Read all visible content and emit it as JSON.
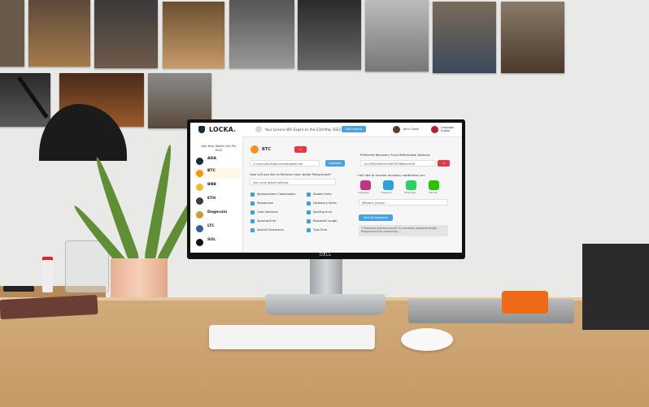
{
  "monitor_brand": "DELL",
  "app": {
    "logo": "LOCKA.",
    "license_notice": "Your Licence Will Expire on the 23rd May 2022",
    "get_license": "Get Licence",
    "user_name": "John Carey",
    "language_label": "Language",
    "language_value": "English"
  },
  "sidebar": {
    "add_wallet": "Add New Wallet Get File Here",
    "coins": [
      {
        "name": "ADA",
        "color": "#1b2a3a"
      },
      {
        "name": "BTC",
        "color": "#f7931a"
      },
      {
        "name": "BNB",
        "color": "#f3ba2f"
      },
      {
        "name": "ETH",
        "color": "#3c3c3d"
      },
      {
        "name": "Dogecoin",
        "color": "#c8a02f"
      },
      {
        "name": "LTC",
        "color": "#345d9d"
      },
      {
        "name": "SOL",
        "color": "#111111"
      }
    ]
  },
  "main": {
    "coin_title": "BTC",
    "wallet_path": "C:\\Users\\ASUS\\Documents\\wallet.dat",
    "upload_label": "Uploaded",
    "recover_question": "How will you like to Recover your wallet Passphrase?",
    "recover_select": "Use Locka default settings",
    "options_left": [
      "Alphanumeric Combination",
      "Passphrase",
      "Case Sensitive",
      "Spacing Error",
      "Special Characters"
    ],
    "options_right": [
      "Double Entry",
      "Dictionary Items",
      "Spelling Error",
      "Password Length",
      "Typo Error"
    ],
    "recovery_fund_label": "Preferred Recovery Fund Withdrawal Address",
    "recovery_fund_address": "1LCV9RQ5N3NX3GH6T4FDNE8znaG9f",
    "notify_label": "I will like to receive recovery notification on:",
    "socials": [
      {
        "name": "Instagram",
        "color": "#c13584"
      },
      {
        "name": "Telegram",
        "color": "#2aa3dc"
      },
      {
        "name": "WhatsApp",
        "color": "#25d366"
      },
      {
        "name": "Wechat",
        "color": "#2dc100"
      }
    ],
    "handle_value": "@Robert_ducalai",
    "find_password_button": "Find My Password",
    "status_text": "7 Password matched out off 10 character password length. Password still on processing ..."
  }
}
